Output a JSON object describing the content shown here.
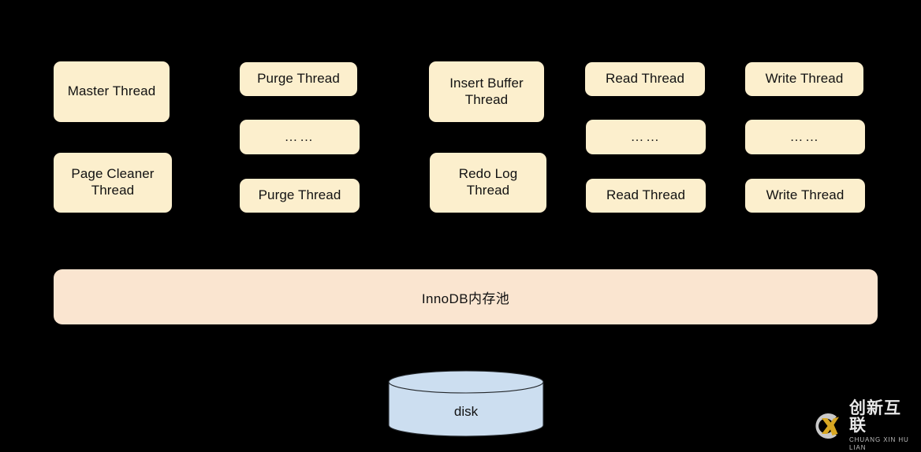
{
  "diagram": {
    "background_color": "#000000",
    "node_fill": "#fcefcd",
    "pool_fill": "#fae5d0",
    "disk_fill": "#ccdef0",
    "columns": [
      {
        "name": "master-column",
        "nodes": [
          {
            "label": "Master Thread",
            "type": "thread"
          },
          {
            "label": "Page Cleaner\nThread",
            "type": "thread"
          }
        ]
      },
      {
        "name": "purge-column",
        "nodes": [
          {
            "label": "Purge Thread",
            "type": "thread"
          },
          {
            "label": "……",
            "type": "ellipsis"
          },
          {
            "label": "Purge Thread",
            "type": "thread"
          }
        ]
      },
      {
        "name": "insert-buffer-column",
        "nodes": [
          {
            "label": "Insert Buffer\nThread",
            "type": "thread"
          },
          {
            "label": "Redo Log\nThread",
            "type": "thread"
          }
        ]
      },
      {
        "name": "read-column",
        "nodes": [
          {
            "label": "Read Thread",
            "type": "thread"
          },
          {
            "label": "……",
            "type": "ellipsis"
          },
          {
            "label": "Read Thread",
            "type": "thread"
          }
        ]
      },
      {
        "name": "write-column",
        "nodes": [
          {
            "label": "Write Thread",
            "type": "thread"
          },
          {
            "label": "……",
            "type": "ellipsis"
          },
          {
            "label": "Write Thread",
            "type": "thread"
          }
        ]
      }
    ],
    "memory_pool": {
      "label": "InnoDB内存池"
    },
    "storage": {
      "label": "disk"
    }
  },
  "watermark": {
    "logo_letter": "CX",
    "name_cn": "创新互联",
    "name_en": "CHUANG XIN HU LIAN",
    "accent_color": "#d8a723"
  }
}
